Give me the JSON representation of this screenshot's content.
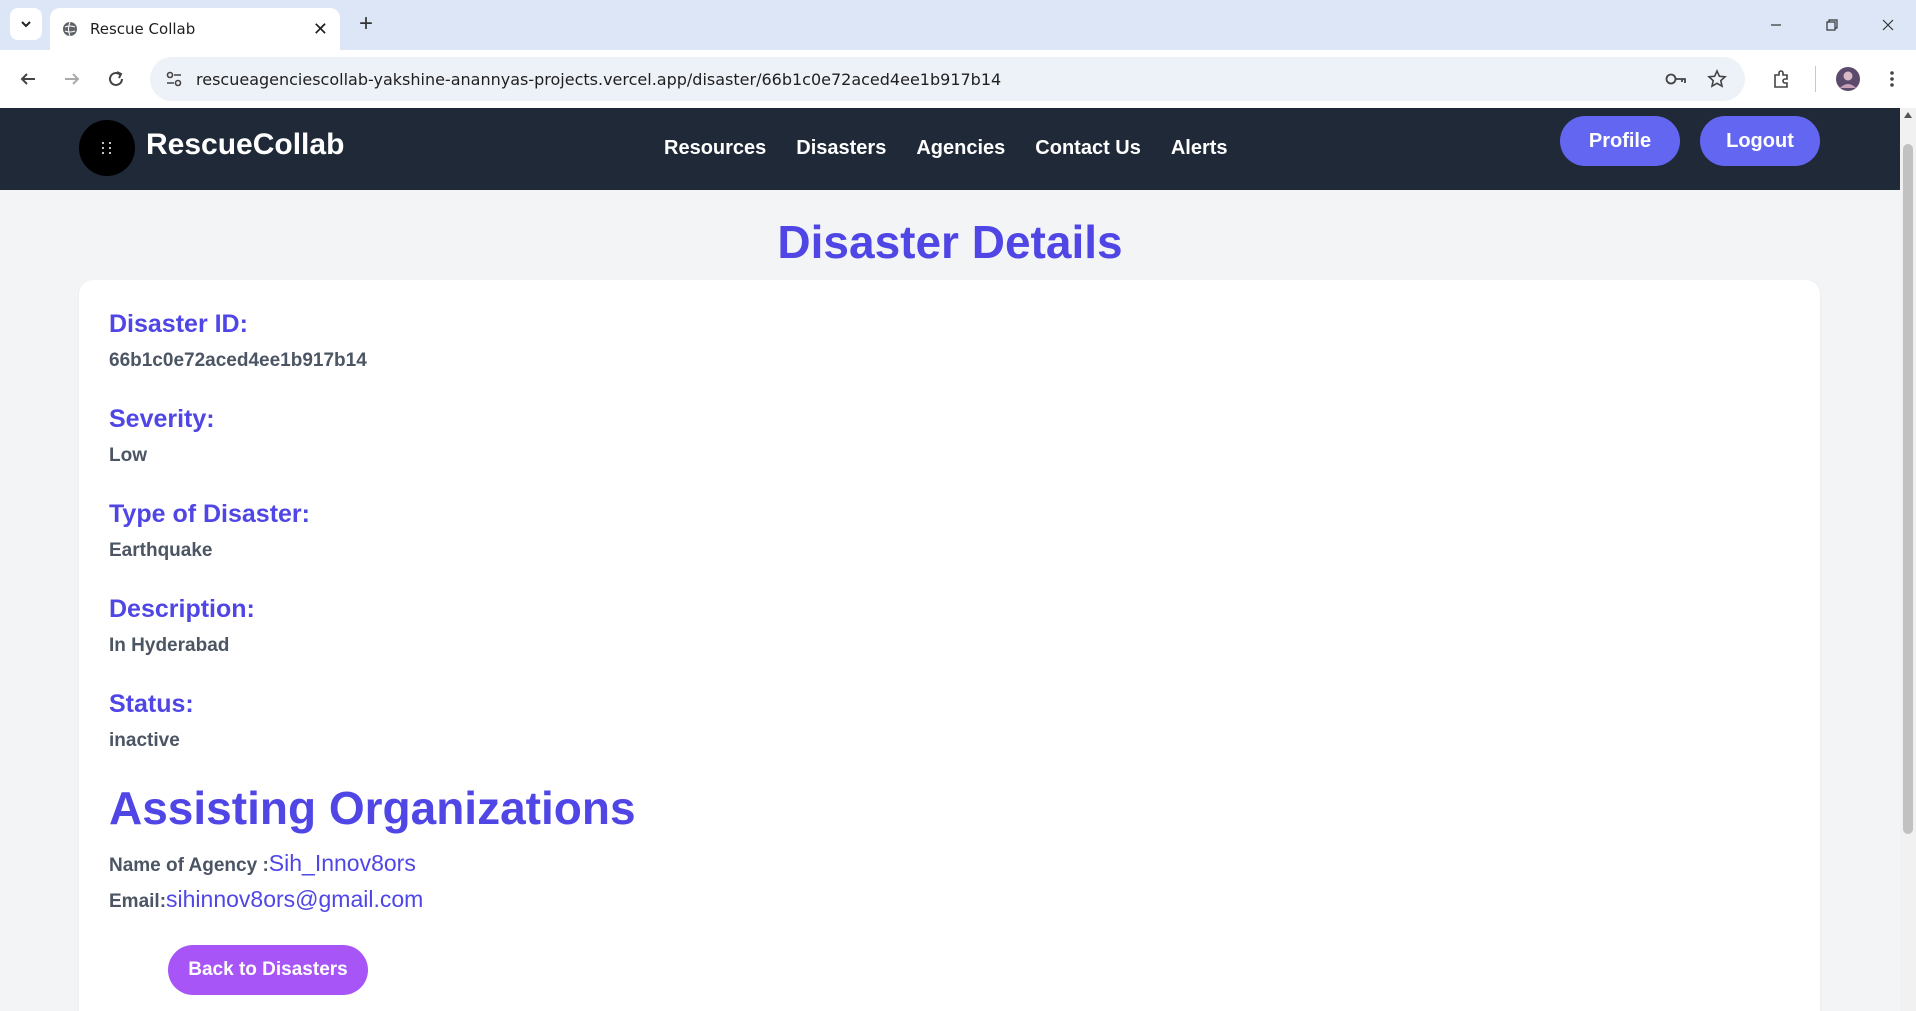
{
  "browser": {
    "tab_title": "Rescue Collab",
    "url": "rescueagenciescollab-yakshine-anannyas-projects.vercel.app/disaster/66b1c0e72aced4ee1b917b14"
  },
  "nav": {
    "brand": "RescueCollab",
    "links": [
      "Resources",
      "Disasters",
      "Agencies",
      "Contact Us",
      "Alerts"
    ],
    "profile_label": "Profile",
    "logout_label": "Logout"
  },
  "page": {
    "title": "Disaster Details"
  },
  "details": {
    "id_label": "Disaster ID:",
    "id_value": "66b1c0e72aced4ee1b917b14",
    "severity_label": "Severity:",
    "severity_value": "Low",
    "type_label": "Type of Disaster:",
    "type_value": "Earthquake",
    "description_label": "Description:",
    "description_value": "In Hyderabad",
    "status_label": "Status:",
    "status_value": "inactive"
  },
  "organizations": {
    "heading": "Assisting Organizations",
    "agency_label": "Name of Agency :",
    "agency_name": "Sih_Innov8ors",
    "email_label": "Email:",
    "email_value": "sihinnov8ors@gmail.com"
  },
  "back_label": "Back to Disasters",
  "colors": {
    "primary": "#4f46e5",
    "button": "#6366f1",
    "back_button": "#a855f7",
    "navbar": "#1f2937"
  }
}
